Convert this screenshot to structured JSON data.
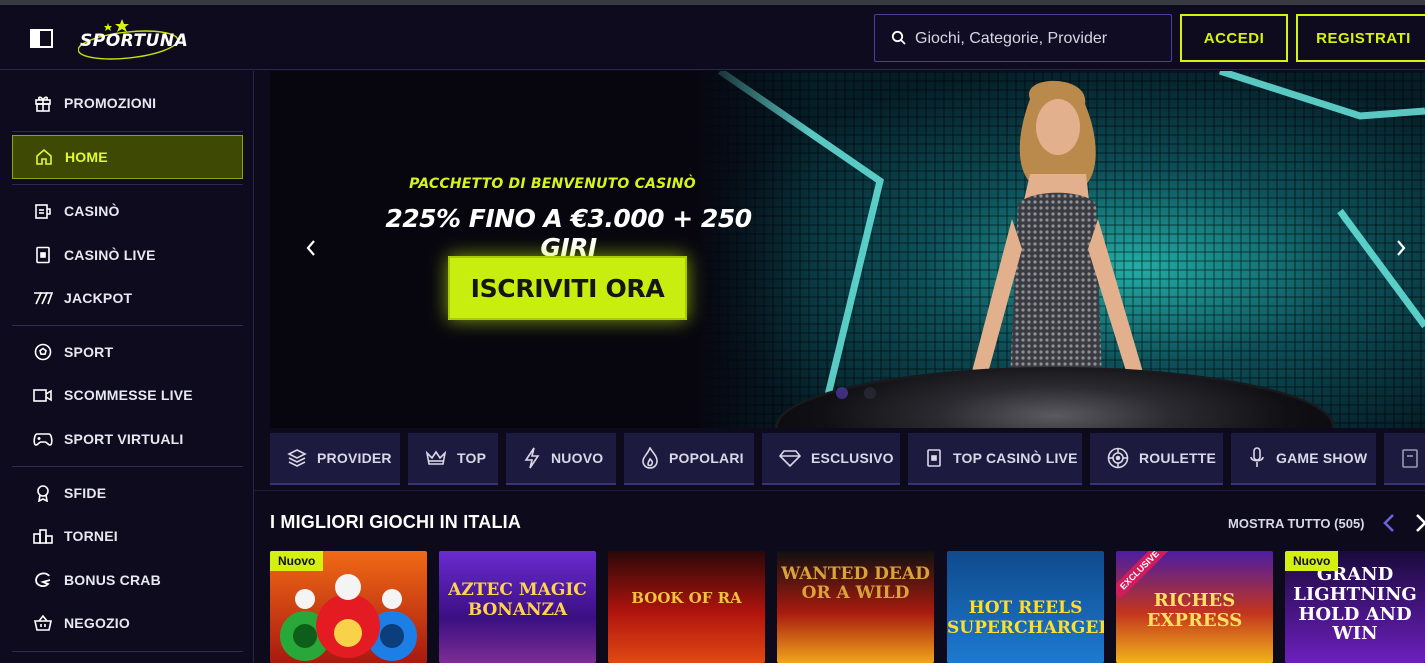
{
  "header": {
    "brand": "SPORTUNA",
    "search_placeholder": "Giochi, Categorie, Provider",
    "login_label": "ACCEDI",
    "register_label": "REGISTRATI"
  },
  "sidebar": {
    "items": [
      {
        "label": "PROMOZIONI",
        "icon": "gift-icon"
      },
      {
        "label": "HOME",
        "icon": "home-icon",
        "active": true
      },
      {
        "label": "CASINÒ",
        "icon": "slot-icon"
      },
      {
        "label": "CASINÒ LIVE",
        "icon": "live-card-icon"
      },
      {
        "label": "JACKPOT",
        "icon": "sevens-icon"
      },
      {
        "label": "SPORT",
        "icon": "soccer-ball-icon"
      },
      {
        "label": "SCOMMESSE LIVE",
        "icon": "video-icon"
      },
      {
        "label": "SPORT VIRTUALI",
        "icon": "gamepad-icon"
      },
      {
        "label": "SFIDE",
        "icon": "medal-icon"
      },
      {
        "label": "TORNEI",
        "icon": "podium-icon"
      },
      {
        "label": "BONUS CRAB",
        "icon": "crab-claw-icon"
      },
      {
        "label": "NEGOZIO",
        "icon": "basket-icon"
      }
    ]
  },
  "banner": {
    "subtitle": "PACCHETTO DI BENVENUTO CASINÒ",
    "title": "225% FINO A €3.000 + 250 GIRI",
    "cta": "ISCRIVITI ORA",
    "slide_count": 2,
    "active_slide": 1
  },
  "categories": [
    {
      "label": "PROVIDER",
      "icon": "layers-icon"
    },
    {
      "label": "TOP",
      "icon": "crown-icon"
    },
    {
      "label": "NUOVO",
      "icon": "lightning-icon"
    },
    {
      "label": "POPOLARI",
      "icon": "flame-icon"
    },
    {
      "label": "ESCLUSIVO",
      "icon": "diamond-icon"
    },
    {
      "label": "TOP CASINÒ LIVE",
      "icon": "live-card-icon"
    },
    {
      "label": "ROULETTE",
      "icon": "roulette-icon"
    },
    {
      "label": "GAME SHOW",
      "icon": "microphone-icon"
    }
  ],
  "section": {
    "title": "I MIGLIORI GIOCHI IN ITALIA",
    "show_all": "MOSTRA TUTTO (505)"
  },
  "games": [
    {
      "title": "",
      "tag": "Nuovo"
    },
    {
      "title": "AZTEC MAGIC BONANZA",
      "tag": ""
    },
    {
      "title": "BOOK OF RA",
      "tag": ""
    },
    {
      "title": "WANTED DEAD OR A WILD",
      "tag": ""
    },
    {
      "title": "HOT REELS SUPERCHARGED",
      "tag": ""
    },
    {
      "title": "RICHES EXPRESS",
      "tag": "EXCLUSIVE"
    },
    {
      "title": "GRAND LIGHTNING HOLD AND WIN",
      "tag": "Nuovo"
    }
  ],
  "colors": {
    "accent": "#d7f20f",
    "background": "#0d0a1c",
    "sidebar_active": "#3e4a04",
    "category_bg": "#1c1b3f"
  }
}
